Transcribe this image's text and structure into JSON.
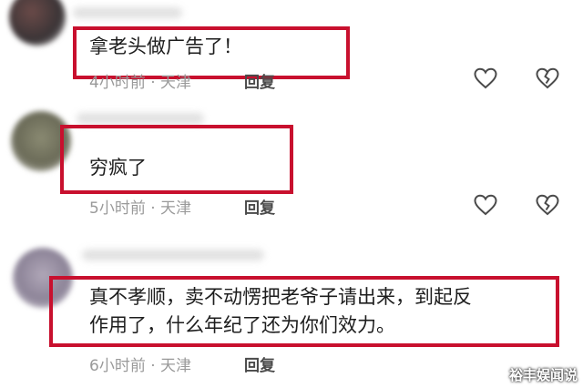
{
  "comments": [
    {
      "text": "拿老头做广告了！",
      "time": "4小时前",
      "location": "天津",
      "reply_label": "回复",
      "like_icon": "heart-outline-icon",
      "dislike_icon": "broken-heart-icon"
    },
    {
      "text": "穷疯了",
      "time": "5小时前",
      "location": "天津",
      "reply_label": "回复",
      "like_icon": "heart-outline-icon",
      "dislike_icon": "broken-heart-icon"
    },
    {
      "text_line1": "真不孝顺，卖不动愣把老爷子请出来，到起反",
      "text_line2": "作用了，什么年纪了还为你们效力。",
      "time": "6小时前",
      "location": "天津",
      "reply_label": "回复",
      "like_icon": "heart-outline-icon",
      "dislike_icon": "broken-heart-icon"
    }
  ],
  "meta_separator": "·",
  "watermark": "裕丰娱闻说",
  "colors": {
    "highlight_box": "#c8102e",
    "meta_text": "#9a9a9a",
    "body_text": "#1d1d1d"
  }
}
